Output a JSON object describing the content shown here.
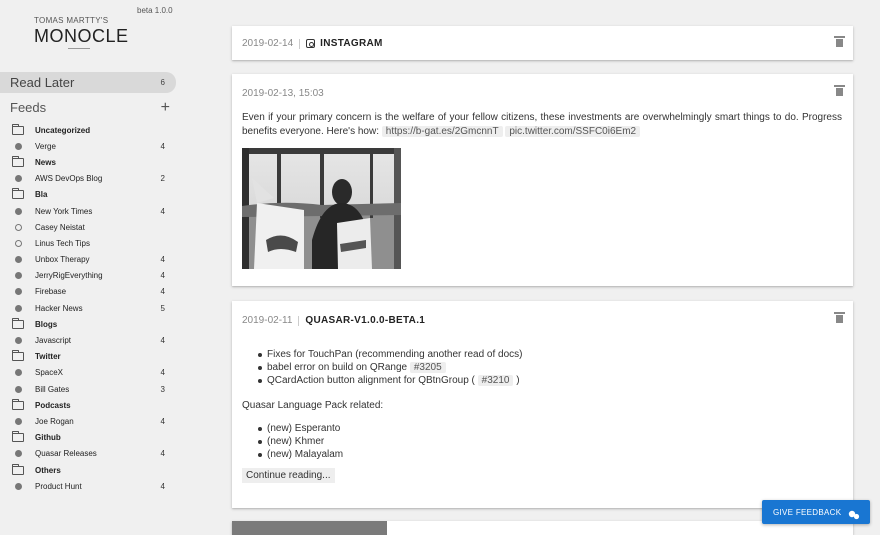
{
  "brand": {
    "by": "TOMAS MARTTY'S",
    "name": "MONOCLE",
    "version": "beta 1.0.0"
  },
  "read_later": {
    "label": "Read Later",
    "count": "6"
  },
  "feeds_header": {
    "label": "Feeds",
    "add_symbol": "+"
  },
  "feeds": [
    {
      "kind": "folder",
      "label": "Uncategorized",
      "count": ""
    },
    {
      "kind": "feed",
      "label": "Verge",
      "count": "4"
    },
    {
      "kind": "folder",
      "label": "News",
      "count": ""
    },
    {
      "kind": "feed",
      "label": "AWS DevOps Blog",
      "count": "2"
    },
    {
      "kind": "folder",
      "label": "Bla",
      "count": ""
    },
    {
      "kind": "feed",
      "label": "New York Times",
      "count": "4"
    },
    {
      "kind": "feed-hollow",
      "label": "Casey Neistat",
      "count": ""
    },
    {
      "kind": "feed-hollow",
      "label": "Linus Tech Tips",
      "count": ""
    },
    {
      "kind": "feed",
      "label": "Unbox Therapy",
      "count": "4"
    },
    {
      "kind": "feed",
      "label": "JerryRigEverything",
      "count": "4"
    },
    {
      "kind": "feed",
      "label": "Firebase",
      "count": "4"
    },
    {
      "kind": "feed",
      "label": "Hacker News",
      "count": "5"
    },
    {
      "kind": "folder",
      "label": "Blogs",
      "count": ""
    },
    {
      "kind": "feed",
      "label": "Javascript",
      "count": "4"
    },
    {
      "kind": "folder",
      "label": "Twitter",
      "count": ""
    },
    {
      "kind": "feed",
      "label": "SpaceX",
      "count": "4"
    },
    {
      "kind": "feed",
      "label": "Bill Gates",
      "count": "3"
    },
    {
      "kind": "folder",
      "label": "Podcasts",
      "count": ""
    },
    {
      "kind": "feed",
      "label": "Joe Rogan",
      "count": "4"
    },
    {
      "kind": "folder",
      "label": "Github",
      "count": ""
    },
    {
      "kind": "feed",
      "label": "Quasar Releases",
      "count": "4"
    },
    {
      "kind": "folder",
      "label": "Others",
      "count": ""
    },
    {
      "kind": "feed",
      "label": "Product Hunt",
      "count": "4"
    }
  ],
  "cards": {
    "instagram": {
      "date": "2019-02-14",
      "icon": "instagram-icon",
      "title": "INSTAGRAM"
    },
    "tweet": {
      "date": "2019-02-13, 15:03",
      "text": "Even if your primary concern is the welfare of your fellow citizens, these investments are overwhelmingly smart things to do. Progress benefits everyone. Here's how:",
      "link1": "https://b-gat.es/2GmcnnT",
      "link2": "pic.twitter.com/SSFC0i6Em2"
    },
    "quasar": {
      "date": "2019-02-11",
      "title": "QUASAR-V1.0.0-BETA.1",
      "bullets1": [
        {
          "text": "Fixes for TouchPan (recommending another read of docs)",
          "tag": ""
        },
        {
          "text": "babel error on build on QRange",
          "tag": "#3205"
        },
        {
          "text": "QCardAction button alignment for QBtnGroup (",
          "tag": "#3210",
          "suffix": ")"
        }
      ],
      "subheading": "Quasar Language Pack related:",
      "bullets2": [
        "(new) Esperanto",
        "(new) Khmer",
        "(new) Malayalam"
      ],
      "continue_label": "Continue reading..."
    }
  },
  "feedback": {
    "label": "GIVE FEEDBACK"
  },
  "colors": {
    "accent": "#1976d2",
    "sidebar_bg": "#f0f0f0",
    "read_later_bg": "#d9d9d9"
  }
}
